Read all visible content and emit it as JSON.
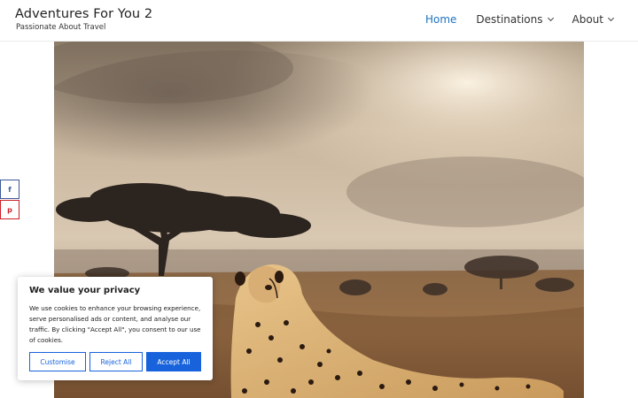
{
  "header": {
    "site_title": "Adventures For You 2",
    "tagline": "Passionate About Travel"
  },
  "nav": {
    "items": [
      {
        "label": "Home",
        "active": true,
        "has_dropdown": false
      },
      {
        "label": "Destinations",
        "active": false,
        "has_dropdown": true
      },
      {
        "label": "About",
        "active": false,
        "has_dropdown": true
      }
    ]
  },
  "hero": {
    "icon": "cheetah-savanna-photo"
  },
  "share": {
    "facebook_glyph": "f",
    "pinterest_glyph": "p"
  },
  "cookie": {
    "title": "We value your privacy",
    "body": "We use cookies to enhance your browsing experience, serve personalised ads or content, and analyse our traffic. By clicking \"Accept All\", you consent to our use of cookies.",
    "customise_label": "Customise",
    "reject_label": "Reject All",
    "accept_label": "Accept All"
  },
  "colors": {
    "accent": "#1e73be",
    "cookie_button": "#1863dc"
  }
}
